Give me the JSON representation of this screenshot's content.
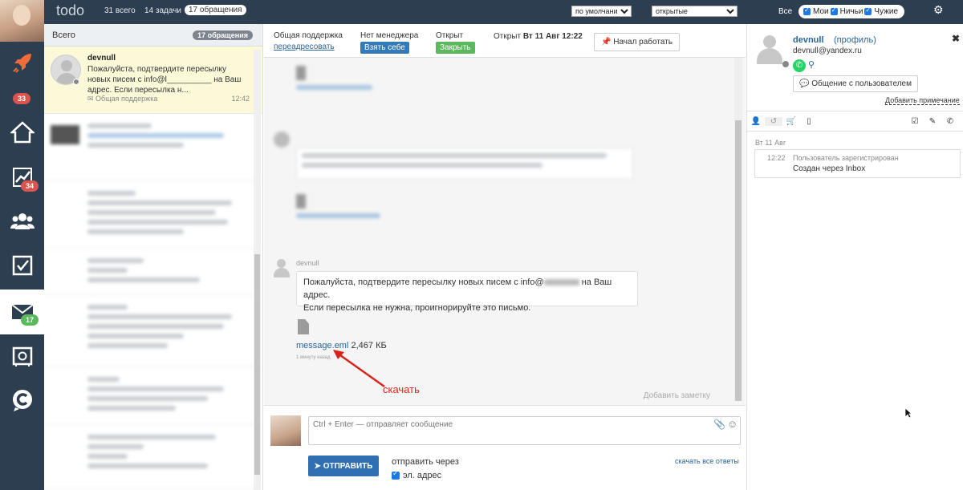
{
  "topbar": {
    "brand": "todo",
    "stat_all": "31 всего",
    "stat_tasks": "14 задачи",
    "stat_requests": "17 обращения",
    "sort_select": "по умолчанию",
    "status_select": "открытые",
    "all_label": "Все",
    "filter_mine": "Мои",
    "filter_nobody": "Ничьи",
    "filter_others": "Чужие"
  },
  "rail": {
    "badge_1": "33",
    "badge_2": "34",
    "badge_3": "17"
  },
  "list": {
    "header": "Всего",
    "header_count": "17 обращения",
    "selected": {
      "name": "devnull",
      "preview": "Пожалуйста, подтвердите пересылку новых писем с info@l__________ на Ваш адрес. Если пересылка н...",
      "source": "Общая поддержка",
      "time": "12:42"
    }
  },
  "conversation": {
    "header": {
      "queue_label": "Общая поддержка",
      "queue_action": "переадресовать",
      "manager_label": "Нет менеджера",
      "take_button": "Взять себе",
      "status_label": "Открыт",
      "close_button": "Закрыть",
      "opened_prefix": "Открыт",
      "opened_date": "Вт 11 Авг 12:22",
      "start_button": "Начал работать"
    },
    "message": {
      "sender": "devnull",
      "text_part1": "Пожалуйста, подтвердите пересылку новых писем с info@",
      "text_part2": " на Ваш адрес.",
      "text_line2": "Если пересылка не нужна, проигнорируйте это письмо."
    },
    "attachment": {
      "file_name": "message.eml",
      "file_size": "2,467 КБ",
      "time_ago": "1 минуту назад"
    },
    "annotation": "скачать",
    "add_note": "Добавить заметку"
  },
  "reply": {
    "placeholder": "Ctrl + Enter — отправляет сообщение",
    "send_button": "ОТПРАВИТЬ",
    "send_via": "отправить через",
    "email_option": "эл. адрес",
    "download_all": "скачать все ответы"
  },
  "profile": {
    "name": "devnull",
    "profile_link": "(профиль)",
    "email": "devnull@yandex.ru",
    "chat_button": "Общение с пользователем",
    "add_note": "Добавить примечание",
    "history_date": "Вт 11 Авг",
    "event_time": "12:22",
    "event_title": "Пользователь зарегистрирован",
    "event_detail": "Создан через Inbox"
  },
  "colors": {
    "dark": "#2d3e50",
    "take": "#337ab7",
    "close": "#5cb85c",
    "badge_red": "#d9534f",
    "badge_green": "#5cb85c",
    "arrow": "#d9241b",
    "link": "#2a6496"
  }
}
